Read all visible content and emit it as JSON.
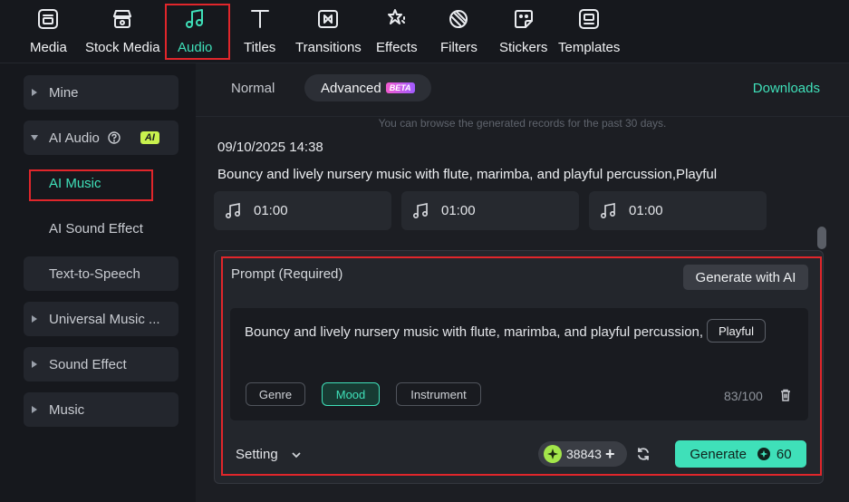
{
  "toolbar": {
    "items": [
      {
        "label": "Media",
        "icon": "media-icon"
      },
      {
        "label": "Stock Media",
        "icon": "stock-media-icon"
      },
      {
        "label": "Audio",
        "icon": "music-note-icon",
        "active": true
      },
      {
        "label": "Titles",
        "icon": "titles-icon"
      },
      {
        "label": "Transitions",
        "icon": "transitions-icon"
      },
      {
        "label": "Effects",
        "icon": "effects-icon"
      },
      {
        "label": "Filters",
        "icon": "filters-icon"
      },
      {
        "label": "Stickers",
        "icon": "stickers-icon"
      },
      {
        "label": "Templates",
        "icon": "templates-icon"
      }
    ]
  },
  "sidebar": {
    "mine": "Mine",
    "ai_audio": "AI Audio",
    "ai_badge": "AI",
    "ai_music": "AI Music",
    "ai_sound_effect": "AI Sound Effect",
    "text_to_speech": "Text-to-Speech",
    "universal_music": "Universal Music ...",
    "sound_effect": "Sound Effect",
    "music": "Music"
  },
  "main": {
    "tab_normal": "Normal",
    "tab_advanced": "Advanced",
    "beta_badge": "BETA",
    "downloads": "Downloads",
    "notice": "You can browse the generated records for the past 30 days.",
    "record_date": "09/10/2025 14:38",
    "record_title": "Bouncy and lively nursery music with flute, marimba, and playful percussion,Playful",
    "tracks": [
      {
        "duration": "01:00"
      },
      {
        "duration": "01:00"
      },
      {
        "duration": "01:00"
      }
    ]
  },
  "prompt": {
    "label": "Prompt (Required)",
    "generate_with_ai": "Generate with AI",
    "text": "Bouncy and lively nursery music with flute, marimba, and playful percussion,",
    "inline_tag": "Playful",
    "chips": {
      "genre": "Genre",
      "mood": "Mood",
      "instrument": "Instrument"
    },
    "counter": "83/100",
    "setting": "Setting",
    "credits": "38843",
    "generate": "Generate",
    "cost": "60"
  },
  "colors": {
    "accent": "#3fe0b9",
    "highlight_red": "#e0262b",
    "ai_badge": "#c8f14e"
  }
}
